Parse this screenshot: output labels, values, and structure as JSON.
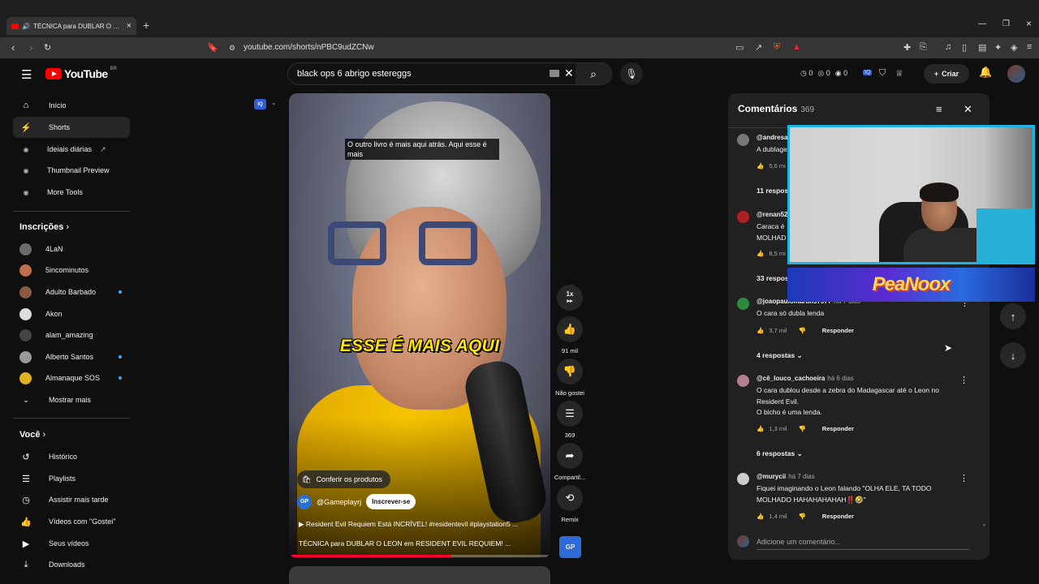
{
  "browser": {
    "tab_title": "TÉCNICA para DUBLAR O LEON",
    "url": "youtube.com/shorts/nPBC9udZCNw"
  },
  "header": {
    "logo_text": "YouTube",
    "region": "BR",
    "search_value": "black ops 6 abrigo estereggs",
    "counters": [
      "0",
      "0",
      "0"
    ],
    "create_label": "Criar"
  },
  "sidebar": {
    "main": [
      {
        "label": "Início",
        "icon": "home-icon"
      },
      {
        "label": "Shorts",
        "icon": "shorts-icon"
      },
      {
        "label": "Ideiais diárias",
        "icon": "extension-icon"
      },
      {
        "label": "Thumbnail Preview",
        "icon": "extension-icon"
      },
      {
        "label": "More Tools",
        "icon": "extension-icon"
      }
    ],
    "subs_title": "Inscrições",
    "subs": [
      {
        "label": "4LaN",
        "color": "#6b6b6b",
        "dot": false
      },
      {
        "label": "5incominutos",
        "color": "#c07050",
        "dot": false
      },
      {
        "label": "Adulto Barbado",
        "color": "#8a5a40",
        "dot": true
      },
      {
        "label": "Akon",
        "color": "#dddddd",
        "dot": false
      },
      {
        "label": "alam_amazing",
        "color": "#444444",
        "dot": false
      },
      {
        "label": "Alberto Santos",
        "color": "#999999",
        "dot": true
      },
      {
        "label": "Almanaque SOS",
        "color": "#e0b020",
        "dot": true
      }
    ],
    "show_more": "Mostrar mais",
    "you_title": "Você",
    "you": [
      {
        "label": "Histórico",
        "icon": "history-icon"
      },
      {
        "label": "Playlists",
        "icon": "playlist-icon"
      },
      {
        "label": "Assistir mais tarde",
        "icon": "clock-icon"
      },
      {
        "label": "Vídeos com \"Gostei\"",
        "icon": "thumbs-up-icon"
      },
      {
        "label": "Seus vídeos",
        "icon": "video-icon"
      },
      {
        "label": "Downloads",
        "icon": "download-icon"
      }
    ]
  },
  "video": {
    "subtitle_box": "O outro livro é mais aqui atrás. Aqui esse é mais",
    "big_caption": "ESSE É MAIS AQUI",
    "products_label": "Conferir os produtos",
    "channel_handle": "@Gameplayrj",
    "subscribe_label": "Inscrever-se",
    "music_line": "Resident Evil Requiem Está INCRÍVEL! #residentevil #playstation5 ...",
    "title_line": "TÉCNICA para DUBLAR O LEON em RESIDENT EVIL REQUIEM! ...",
    "progress": 0.62
  },
  "actions": {
    "speed": "1x",
    "likes": "91 mil",
    "dislike_label": "Não gostei",
    "comments": "369",
    "share_label": "Compartil...",
    "remix_label": "Remix"
  },
  "comments": {
    "title": "Comentários",
    "count": "369",
    "items": [
      {
        "user": "@andresa",
        "when": "",
        "lines": [
          "A dublage"
        ],
        "likes": "5,6 mi",
        "avatar": "#777777"
      },
      {
        "user": "@renan52",
        "when": "",
        "lines": [
          "Caraca é",
          "MOLHAD"
        ],
        "likes": "8,5 mi",
        "avatar": "#b02020"
      },
      {
        "user": "@joaopaulomartins7977",
        "when": "há 7 dias",
        "lines": [
          "O cara só dubla lenda"
        ],
        "likes": "3,7 mil",
        "avatar": "#2e8b3e"
      },
      {
        "user": "@cê_louco_cachoeira",
        "when": "há 6 dias",
        "lines": [
          "O cara dublou desde a zebra do Madagascar até o Leon no",
          "Resident Evil.",
          "O bicho é uma lenda."
        ],
        "likes": "1,3 mil",
        "avatar": "#b08090"
      },
      {
        "user": "@murycii",
        "when": "há 7 dias",
        "lines": [
          "Fiquei imaginando o Leon falando \"OLHA ELE, TA TODO",
          "MOLHADO HAHAHAHAHAH‼️🤣\""
        ],
        "likes": "1,4 mil",
        "avatar": "#cccccc"
      }
    ],
    "replies": [
      "11 respostas",
      "33 respostas",
      "4 respostas",
      "6 respostas"
    ],
    "reply_label": "Responder",
    "add_placeholder": "Adicione um comentário..."
  },
  "overlay": {
    "brand": "PeaNoox"
  }
}
